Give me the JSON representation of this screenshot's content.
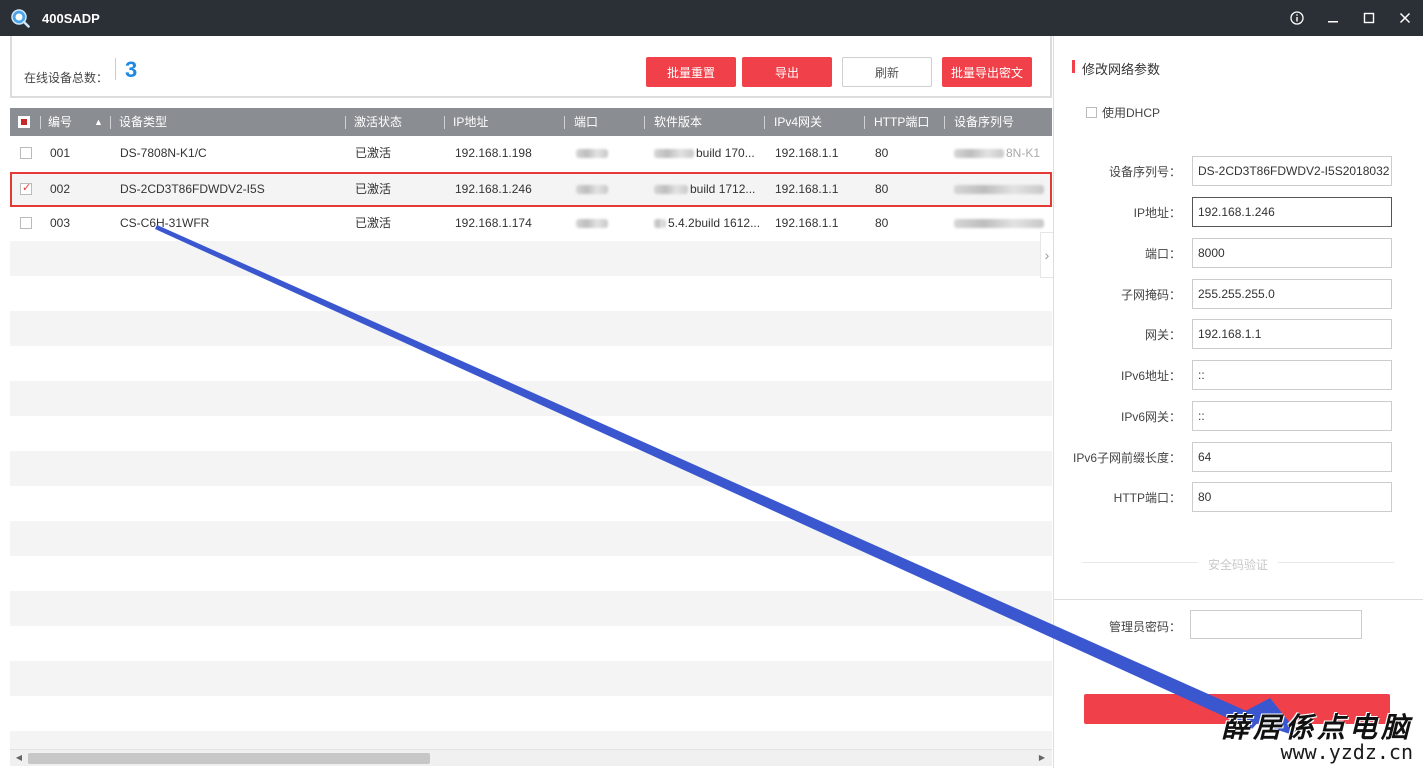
{
  "app": {
    "title": "400SADP"
  },
  "summary": {
    "label": "在线设备总数：",
    "count": "3"
  },
  "toolbar": {
    "batch_reset": "批量重置",
    "export": "导出",
    "refresh": "刷新",
    "batch_export_cipher": "批量导出密文"
  },
  "table": {
    "headers": [
      "编号",
      "设备类型",
      "激活状态",
      "IP地址",
      "端口",
      "软件版本",
      "IPv4网关",
      "HTTP端口",
      "设备序列号"
    ],
    "rows": [
      {
        "no": "001",
        "type": "DS-7808N-K1/C",
        "status": "已激活",
        "ip": "192.168.1.198",
        "version": "build 170...",
        "gateway": "192.168.1.1",
        "http": "80",
        "serial": "8N-K1",
        "checked": false
      },
      {
        "no": "002",
        "type": "DS-2CD3T86FDWDV2-I5S",
        "status": "已激活",
        "ip": "192.168.1.246",
        "version": "build 1712...",
        "gateway": "192.168.1.1",
        "http": "80",
        "serial": "",
        "checked": true
      },
      {
        "no": "003",
        "type": "CS-C6H-31WFR",
        "status": "已激活",
        "ip": "192.168.1.174",
        "version": "5.4.2build 1612...",
        "gateway": "192.168.1.1",
        "http": "80",
        "serial": "",
        "checked": false
      }
    ]
  },
  "panel": {
    "title": "修改网络参数",
    "dhcp_label": "使用DHCP",
    "fields": [
      {
        "label": "设备序列号：",
        "value": "DS-2CD3T86FDWDV2-I5S2018032"
      },
      {
        "label": "IP地址：",
        "value": "192.168.1.246"
      },
      {
        "label": "端口：",
        "value": "8000"
      },
      {
        "label": "子网掩码：",
        "value": "255.255.255.0"
      },
      {
        "label": "网关：",
        "value": "192.168.1.1"
      },
      {
        "label": "IPv6地址：",
        "value": "::"
      },
      {
        "label": "IPv6网关：",
        "value": "::"
      },
      {
        "label": "IPv6子网前缀长度：",
        "value": "64"
      },
      {
        "label": "HTTP端口：",
        "value": "80"
      }
    ],
    "security_label": "安全码验证",
    "admin_password_label": "管理员密码："
  },
  "watermark": {
    "text": "薛居係点电脑",
    "url": "www.yzdz.cn"
  },
  "colors": {
    "accent_red": "#f0414a",
    "count_blue": "#1e88e5",
    "title_bar": "#2b2f36",
    "arrow_blue": "#3a57d0"
  }
}
